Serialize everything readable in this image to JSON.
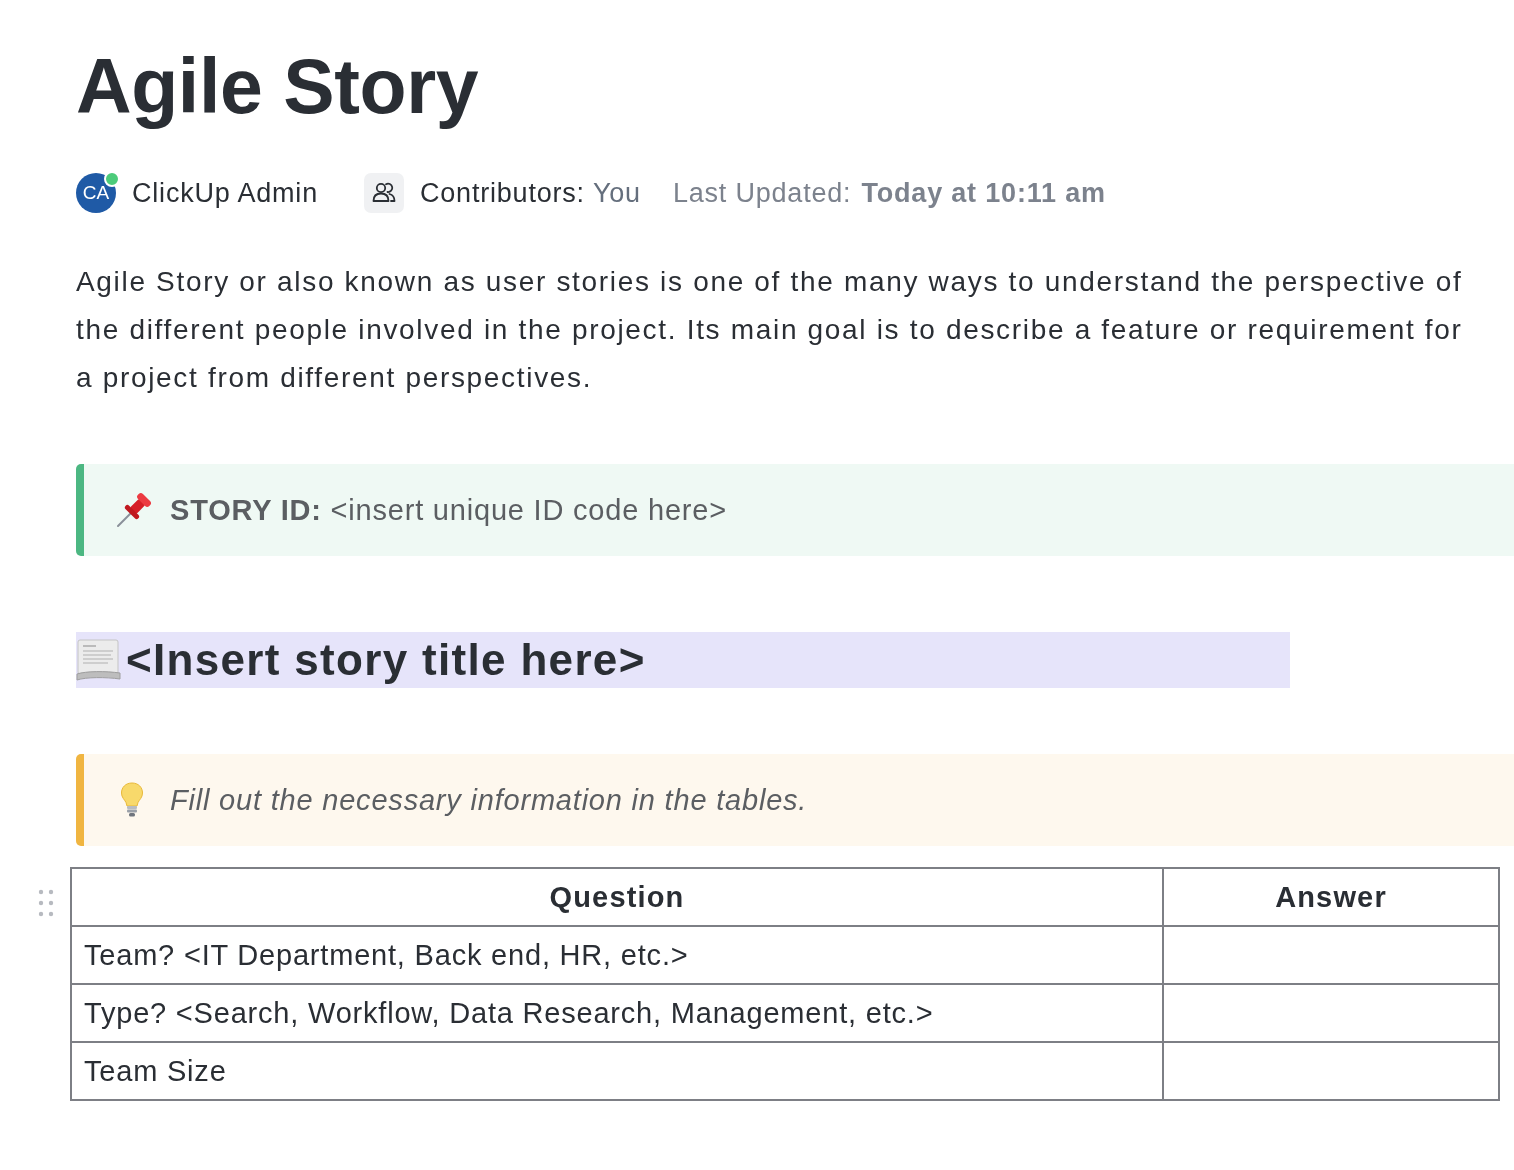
{
  "title": "Agile Story",
  "meta": {
    "author": {
      "initials": "CA",
      "name": "ClickUp Admin",
      "online": true
    },
    "contributors_label": "Contributors:",
    "contributors_value": "You",
    "updated_label": "Last Updated:",
    "updated_value": "Today at 10:11 am"
  },
  "intro": "Agile Story or also known as user stories is one of the many ways to understand the perspective of the different people involved in the project. Its main goal is to describe a feature or requirement for a project from different perspectives.",
  "blocks": [
    {
      "kind": "pin_callout",
      "color": "#4cb782",
      "text": "**STORY ID:** <insert unique ID code here>"
    },
    {
      "kind": "heading",
      "text": "<Insert story title here>"
    },
    {
      "kind": "tip_callout",
      "color": "#f0b541",
      "text": "Fill out the necessary information in the tables."
    },
    {
      "kind": "table",
      "columns": [
        "Question",
        "Answer"
      ],
      "rows": [
        {
          "cells": [
            "Team? <IT Department, Back end, HR, etc.>"
          ]
        },
        {
          "cells": [
            "Type? <Search, Workflow, Data Research, Management, etc.>"
          ]
        },
        {
          "cells": [
            "Team Size"
          ]
        }
      ]
    }
  ]
}
